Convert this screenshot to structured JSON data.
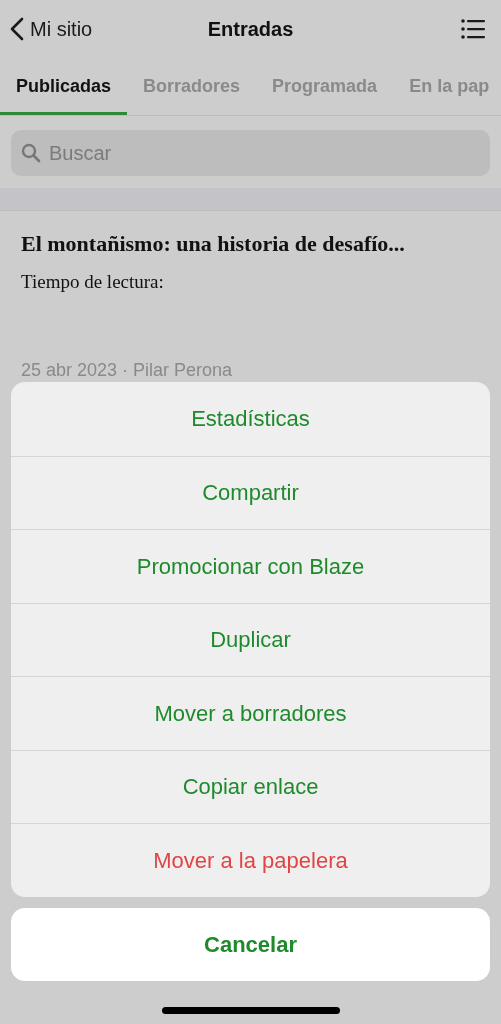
{
  "nav": {
    "back_label": "Mi sitio",
    "title": "Entradas"
  },
  "tabs": [
    {
      "label": "Publicadas",
      "selected": true
    },
    {
      "label": "Borradores",
      "selected": false
    },
    {
      "label": "Programada",
      "selected": false
    },
    {
      "label": "En la pap",
      "selected": false
    }
  ],
  "search": {
    "placeholder": "Buscar"
  },
  "post": {
    "title": "El montañismo: una historia de desafío...",
    "excerpt": "Tiempo de lectura:",
    "meta": "25 abr 2023 · Pilar Perona"
  },
  "action_sheet": {
    "actions": [
      {
        "label": "Estadísticas",
        "kind": "default"
      },
      {
        "label": "Compartir",
        "kind": "default"
      },
      {
        "label": "Promocionar con Blaze",
        "kind": "default"
      },
      {
        "label": "Duplicar",
        "kind": "default"
      },
      {
        "label": "Mover a borradores",
        "kind": "default"
      },
      {
        "label": "Copiar enlace",
        "kind": "default"
      },
      {
        "label": "Mover a la papelera",
        "kind": "destructive"
      }
    ],
    "cancel": "Cancelar"
  }
}
